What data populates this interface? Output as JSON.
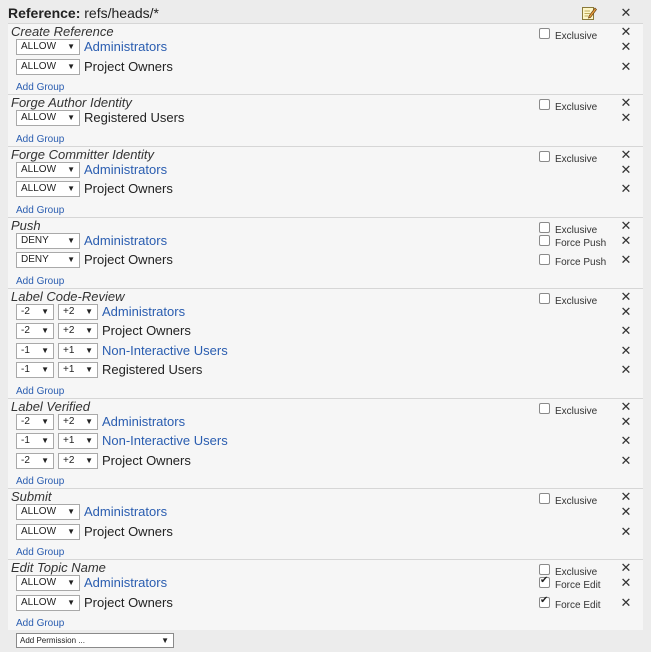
{
  "reference": {
    "label": "Reference:",
    "name": "refs/heads/*",
    "edit_icon": "edit-pencil-icon",
    "remove_icon": "close-icon"
  },
  "add_group_label": "Add Group",
  "exclusive_label": "Exclusive",
  "remove_glyph": "✕",
  "add_permission_label": "Add Permission ...",
  "permissions": [
    {
      "name": "Create Reference",
      "exclusive_checked": false,
      "extra": [],
      "rules": [
        {
          "action": "ALLOW",
          "group": "Administrators",
          "link": true
        },
        {
          "action": "ALLOW",
          "group": "Project Owners",
          "link": false
        }
      ]
    },
    {
      "name": "Forge Author Identity",
      "exclusive_checked": false,
      "extra": [],
      "rules": [
        {
          "action": "ALLOW",
          "group": "Registered Users",
          "link": false
        }
      ]
    },
    {
      "name": "Forge Committer Identity",
      "exclusive_checked": false,
      "extra": [],
      "rules": [
        {
          "action": "ALLOW",
          "group": "Administrators",
          "link": true
        },
        {
          "action": "ALLOW",
          "group": "Project Owners",
          "link": false
        }
      ]
    },
    {
      "name": "Push",
      "exclusive_checked": false,
      "extra": [],
      "rules": [
        {
          "action": "DENY",
          "group": "Administrators",
          "link": true,
          "extra_label": "Force Push",
          "extra_checked": false
        },
        {
          "action": "DENY",
          "group": "Project Owners",
          "link": false,
          "extra_label": "Force Push",
          "extra_checked": false
        }
      ]
    },
    {
      "name": "Label Code-Review",
      "exclusive_checked": false,
      "range": true,
      "rules": [
        {
          "min": "-2",
          "max": "+2",
          "group": "Administrators",
          "link": true
        },
        {
          "min": "-2",
          "max": "+2",
          "group": "Project Owners",
          "link": false
        },
        {
          "min": "-1",
          "max": "+1",
          "group": "Non-Interactive Users",
          "link": true
        },
        {
          "min": "-1",
          "max": "+1",
          "group": "Registered Users",
          "link": false
        }
      ]
    },
    {
      "name": "Label Verified",
      "exclusive_checked": false,
      "range": true,
      "rules": [
        {
          "min": "-2",
          "max": "+2",
          "group": "Administrators",
          "link": true
        },
        {
          "min": "-1",
          "max": "+1",
          "group": "Non-Interactive Users",
          "link": true
        },
        {
          "min": "-2",
          "max": "+2",
          "group": "Project Owners",
          "link": false
        }
      ]
    },
    {
      "name": "Submit",
      "exclusive_checked": false,
      "rules": [
        {
          "action": "ALLOW",
          "group": "Administrators",
          "link": true
        },
        {
          "action": "ALLOW",
          "group": "Project Owners",
          "link": false
        }
      ]
    },
    {
      "name": "Edit Topic Name",
      "exclusive_checked": false,
      "rules": [
        {
          "action": "ALLOW",
          "group": "Administrators",
          "link": true,
          "extra_label": "Force Edit",
          "extra_checked": true
        },
        {
          "action": "ALLOW",
          "group": "Project Owners",
          "link": false,
          "extra_label": "Force Edit",
          "extra_checked": true
        }
      ]
    }
  ]
}
